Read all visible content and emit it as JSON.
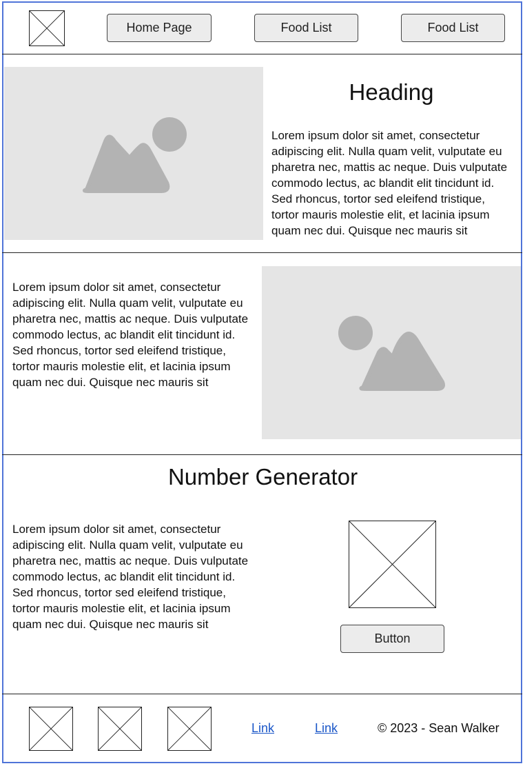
{
  "header": {
    "logo_icon": "placeholder-image-icon",
    "nav": [
      {
        "label": "Home Page"
      },
      {
        "label": "Food List"
      },
      {
        "label": "Food List"
      }
    ]
  },
  "section1": {
    "image_icon": "image-placeholder-icon",
    "heading": "Heading",
    "text": "Lorem ipsum dolor sit amet, consectetur adipiscing elit. Nulla quam velit, vulputate eu pharetra nec, mattis ac neque. Duis vulputate commodo lectus, ac blandit elit tincidunt id. Sed rhoncus, tortor sed eleifend tristique, tortor mauris molestie elit, et lacinia ipsum quam nec dui. Quisque nec mauris sit"
  },
  "section2": {
    "text": "Lorem ipsum dolor sit amet, consectetur adipiscing elit. Nulla quam velit, vulputate eu pharetra nec, mattis ac neque. Duis vulputate commodo lectus, ac blandit elit tincidunt id. Sed rhoncus, tortor sed eleifend tristique, tortor mauris molestie elit, et lacinia ipsum quam nec dui. Quisque nec mauris sit",
    "image_icon": "image-placeholder-icon"
  },
  "section3": {
    "heading": "Number Generator",
    "text": "Lorem ipsum dolor sit amet, consectetur adipiscing elit. Nulla quam velit, vulputate eu pharetra nec, mattis ac neque. Duis vulputate commodo lectus, ac blandit elit tincidunt id. Sed rhoncus, tortor sed eleifend tristique, tortor mauris molestie elit, et lacinia ipsum quam nec dui. Quisque nec mauris sit",
    "image_icon": "placeholder-image-icon",
    "button_label": "Button"
  },
  "footer": {
    "icons": [
      "placeholder-image-icon",
      "placeholder-image-icon",
      "placeholder-image-icon"
    ],
    "links": [
      {
        "label": "Link"
      },
      {
        "label": "Link"
      }
    ],
    "copyright": "© 2023 - Sean Walker"
  },
  "colors": {
    "frame_border": "#4f74d8",
    "placeholder_bg": "#e5e5e5",
    "placeholder_shape": "#b3b3b3",
    "button_bg": "#ececec",
    "link": "#1a56c8"
  }
}
